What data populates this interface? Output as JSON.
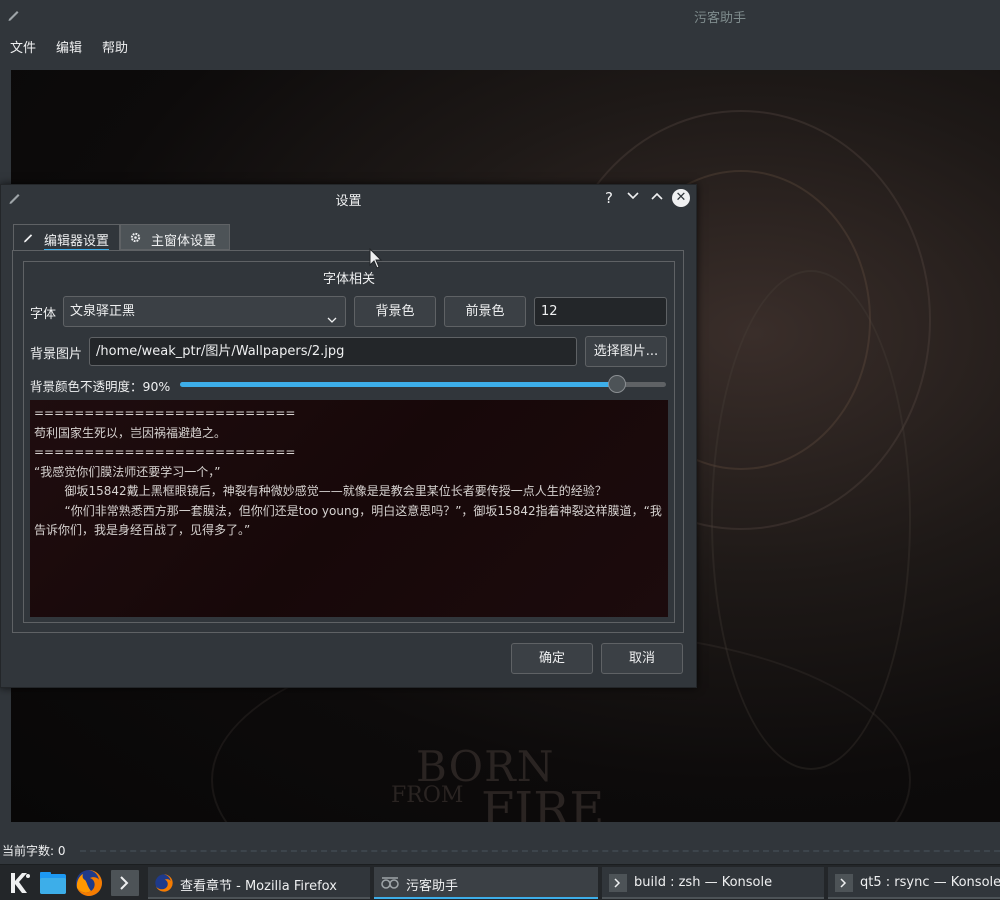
{
  "main_window": {
    "title": "污客助手",
    "menu": [
      "文件",
      "编辑",
      "帮助"
    ],
    "status_text": "当前字数: 0",
    "watermark": {
      "line1": "BORN",
      "line2": "FROM",
      "line3": "FIRE"
    }
  },
  "dialog": {
    "title": "设置",
    "buttons": {
      "help": "?",
      "minimize": "⌄",
      "maximize": "^",
      "close": "✕"
    },
    "tabs": [
      {
        "label": "编辑器设置",
        "icon": "pencil-icon",
        "active": true
      },
      {
        "label": "主窗体设置",
        "icon": "gear-icon",
        "active": false
      }
    ],
    "group_title": "字体相关",
    "font_label": "字体",
    "font_value": "文泉驿正黑",
    "bg_color_button": "背景色",
    "fg_color_button": "前景色",
    "font_size_value": "12",
    "bg_image_label": "背景图片",
    "bg_image_path": "/home/weak_ptr/图片/Wallpapers/2.jpg",
    "choose_image_button": "选择图片...",
    "opacity_label": "背景颜色不透明度：90%",
    "opacity_value": 0.9,
    "preview_lines": [
      "==========================",
      "苟利国家生死以，岂因祸福避趋之。",
      "==========================",
      "“我感觉你们膜法师还要学习一个，”",
      "        御坂15842戴上黑框眼镜后，神裂有种微妙感觉——就像是是教会里某位长者要传授一点人生的经验？",
      "        “你们非常熟悉西方那一套膜法，但你们还是too young，明白这意思吗？”，御坂15842指着神裂这样膜道，“我告诉你们，我是身经百战了，见得多了。”"
    ],
    "ok_button": "确定",
    "cancel_button": "取消"
  },
  "taskbar": {
    "tasks": [
      {
        "label": "查看章节 - Mozilla Firefox",
        "icon": "firefox-icon"
      },
      {
        "label": "污客助手",
        "icon": "app-icon"
      },
      {
        "label": "build : zsh — Konsole",
        "icon": "terminal-icon"
      },
      {
        "label": "qt5 : rsync — Konsole",
        "icon": "terminal-icon"
      }
    ]
  },
  "colors": {
    "accent": "#3daee9",
    "window": "#31363b",
    "taskbar": "#232629"
  }
}
